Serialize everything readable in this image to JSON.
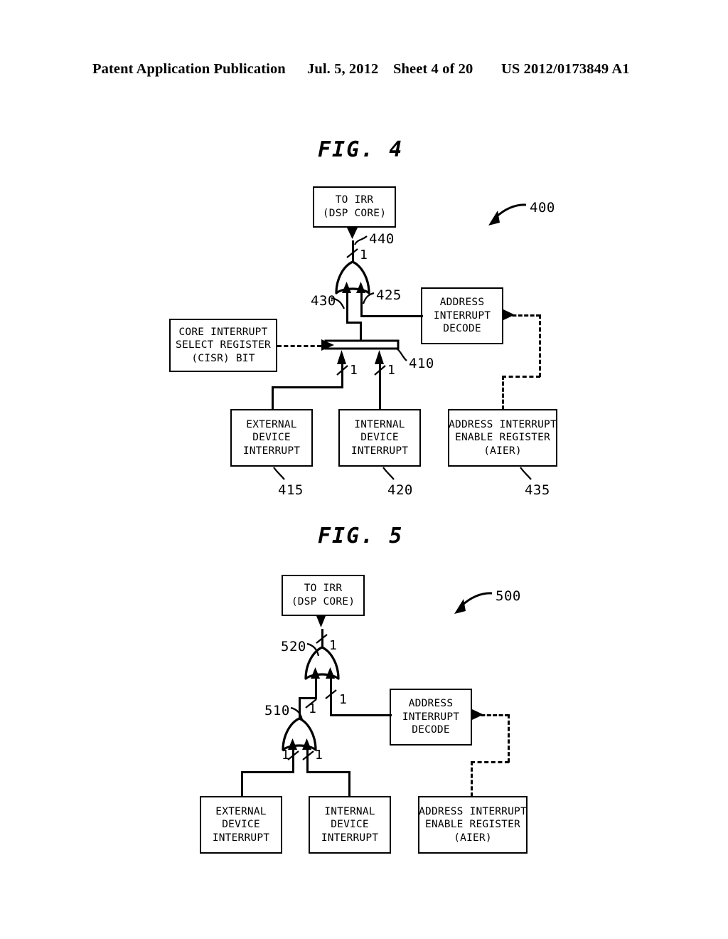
{
  "header": {
    "publication": "Patent Application Publication",
    "date": "Jul. 5, 2012",
    "sheet": "Sheet 4 of 20",
    "number": "US 2012/0173849 A1"
  },
  "figures": [
    {
      "caption": "FIG. 4",
      "system_ref": "400",
      "boxes": [
        {
          "name": "to-irr",
          "lines": [
            "TO IRR",
            "(DSP CORE)"
          ]
        },
        {
          "name": "address-interrupt-decode",
          "lines": [
            "ADDRESS",
            "INTERRUPT",
            "DECODE"
          ]
        },
        {
          "name": "core-interrupt-select-register",
          "lines": [
            "CORE INTERRUPT",
            "SELECT REGISTER",
            "(CISR) BIT"
          ]
        },
        {
          "name": "external-device-interrupt",
          "lines": [
            "EXTERNAL",
            "DEVICE",
            "INTERRUPT"
          ]
        },
        {
          "name": "internal-device-interrupt",
          "lines": [
            "INTERNAL",
            "DEVICE",
            "INTERRUPT"
          ]
        },
        {
          "name": "address-interrupt-enable-register",
          "lines": [
            "ADDRESS INTERRUPT",
            "ENABLE REGISTER",
            "(AIER)"
          ]
        }
      ],
      "refs": {
        "or_gate_output": "440",
        "or_gate": "430",
        "decode_input": "425",
        "multiplexer": "410",
        "external_device_interrupt": "415",
        "internal_device_interrupt": "420",
        "address_interrupt_enable_register": "435"
      },
      "bus_labels": {
        "or_gate_output": "1",
        "mux_input_left": "1",
        "mux_input_right": "1"
      }
    },
    {
      "caption": "FIG. 5",
      "system_ref": "500",
      "boxes": [
        {
          "name": "to-irr",
          "lines": [
            "TO IRR",
            "(DSP CORE)"
          ]
        },
        {
          "name": "address-interrupt-decode",
          "lines": [
            "ADDRESS",
            "INTERRUPT",
            "DECODE"
          ]
        },
        {
          "name": "external-device-interrupt",
          "lines": [
            "EXTERNAL",
            "DEVICE",
            "INTERRUPT"
          ]
        },
        {
          "name": "internal-device-interrupt",
          "lines": [
            "INTERNAL",
            "DEVICE",
            "INTERRUPT"
          ]
        },
        {
          "name": "address-interrupt-enable-register",
          "lines": [
            "ADDRESS INTERRUPT",
            "ENABLE REGISTER",
            "(AIER)"
          ]
        }
      ],
      "refs": {
        "upper_or_gate": "520",
        "lower_or_gate": "510"
      },
      "bus_labels": {
        "upper_gate_output": "1",
        "upper_gate_input_left": "1",
        "upper_gate_input_right": "1",
        "lower_gate_input_left": "1",
        "lower_gate_input_right": "1"
      }
    }
  ]
}
